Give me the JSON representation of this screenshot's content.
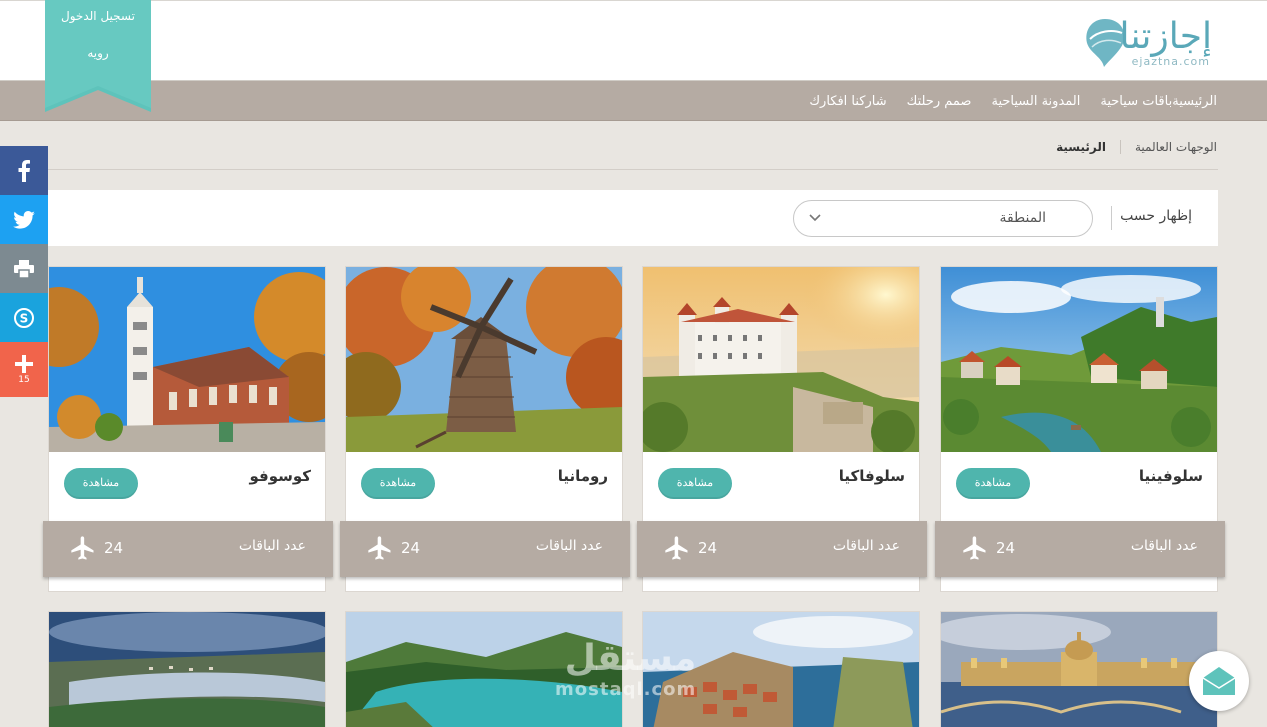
{
  "brand": {
    "name": "إجازتنا",
    "domain": "ejaztna.com"
  },
  "login": {
    "line1": "تسجيل الدخول",
    "line2": "رويه"
  },
  "nav": [
    {
      "label": "الرئيسية"
    },
    {
      "label": "باقات سياحية"
    },
    {
      "label": "المدونة السياحية"
    },
    {
      "label": "صمم رحلتك"
    },
    {
      "label": "شاركنا افكارك"
    }
  ],
  "breadcrumb": {
    "home": "الرئيسية",
    "current": "الوجهات العالمية"
  },
  "filter": {
    "label": "إظهار حسب",
    "selected": "المنطقة"
  },
  "social": {
    "share_count": "15"
  },
  "cards": [
    {
      "title": "سلوفينيا",
      "view": "مشاهدة",
      "packages_label": "عدد الباقات",
      "packages": "24"
    },
    {
      "title": "سلوفاكيا",
      "view": "مشاهدة",
      "packages_label": "عدد الباقات",
      "packages": "24"
    },
    {
      "title": "رومانيا",
      "view": "مشاهدة",
      "packages_label": "عدد الباقات",
      "packages": "24"
    },
    {
      "title": "كوسوفو",
      "view": "مشاهدة",
      "packages_label": "عدد الباقات",
      "packages": "24"
    }
  ],
  "watermark": {
    "text": "مستقل",
    "sub": "mostaql.com"
  },
  "colors": {
    "accent": "#4fb5ad",
    "nav": "#b5aba3",
    "brand": "#5aa8b8"
  }
}
